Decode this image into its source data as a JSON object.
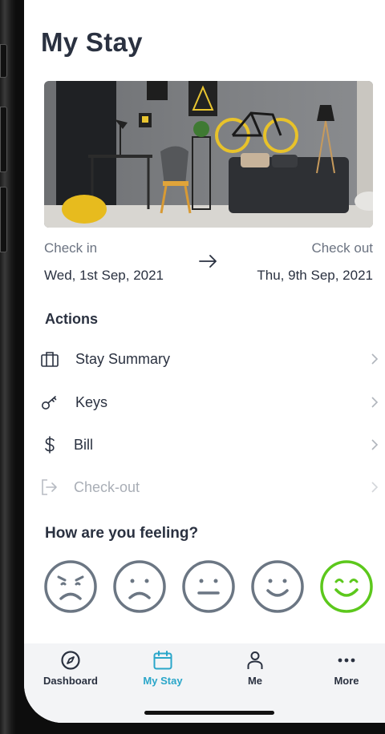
{
  "page": {
    "title": "My Stay"
  },
  "stay": {
    "check_in_label": "Check in",
    "check_in_date": "Wed, 1st Sep, 2021",
    "check_out_label": "Check out",
    "check_out_date": "Thu, 9th Sep, 2021"
  },
  "actions": {
    "title": "Actions",
    "items": [
      {
        "label": "Stay Summary",
        "icon": "suitcase-icon",
        "enabled": true
      },
      {
        "label": "Keys",
        "icon": "key-icon",
        "enabled": true
      },
      {
        "label": "Bill",
        "icon": "dollar-icon",
        "enabled": true
      },
      {
        "label": "Check-out",
        "icon": "exit-icon",
        "enabled": false
      }
    ]
  },
  "feeling": {
    "title": "How are you feeling?",
    "options": [
      "very-sad",
      "sad",
      "neutral",
      "happy",
      "very-happy"
    ],
    "selected": "very-happy"
  },
  "tabbar": {
    "items": [
      {
        "label": "Dashboard",
        "icon": "compass-icon"
      },
      {
        "label": "My Stay",
        "icon": "calendar-icon"
      },
      {
        "label": "Me",
        "icon": "person-icon"
      },
      {
        "label": "More",
        "icon": "more-dots-icon"
      }
    ],
    "active": "My Stay"
  },
  "colors": {
    "text": "#2a3140",
    "muted": "#6b7381",
    "accent": "#2aa6c9",
    "selected_face": "#5cc81c",
    "face": "#6b7683"
  }
}
